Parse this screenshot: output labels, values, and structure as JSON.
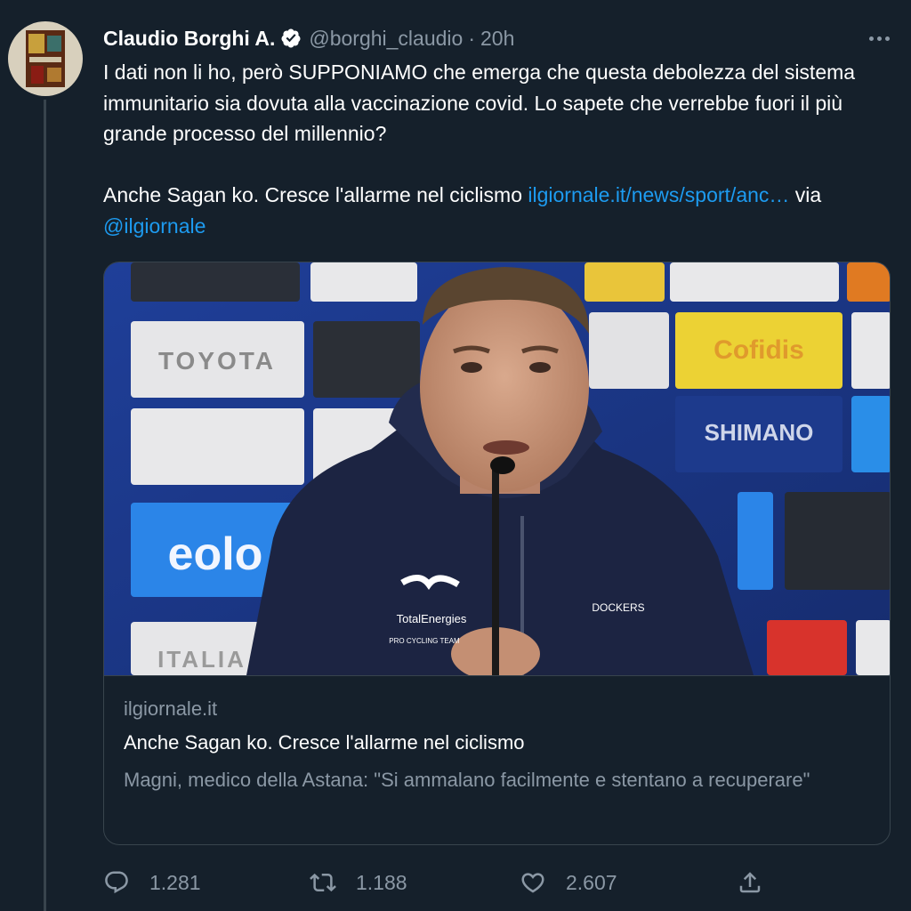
{
  "author": {
    "name": "Claudio Borghi A.",
    "handle": "@borghi_claudio",
    "separator": "·",
    "time": "20h"
  },
  "tweet": {
    "paragraph1": "I dati non li ho, però SUPPONIAMO che emerga che questa debolezza del sistema immunitario sia dovuta alla vaccinazione covid. Lo sapete che verrebbe fuori il più grande processo del millennio?",
    "paragraph2_text": "Anche Sagan ko. Cresce l'allarme nel ciclismo ",
    "paragraph2_link": "ilgiornale.it/news/sport/anc…",
    "via_text": " via ",
    "mention": "@ilgiornale"
  },
  "card": {
    "domain": "ilgiornale.it",
    "title": "Anche Sagan ko. Cresce l'allarme nel ciclismo",
    "description": "Magni, medico della Astana: \"Si ammalano facilmente e stentano a recuperare\"",
    "image_sponsors": [
      "TOYOTA",
      "Cofidis",
      "SHIMANO",
      "eolo",
      "ITALIA"
    ],
    "jersey_text": [
      "TotalEnergies",
      "PRO CYCLING TEAM",
      "DOCKERS"
    ]
  },
  "actions": {
    "replies": "1.281",
    "retweets": "1.188",
    "likes": "2.607"
  },
  "colors": {
    "background": "#15202b",
    "accent": "#1d9bf0",
    "muted": "#8b98a5",
    "border": "#38444d"
  },
  "icons": [
    "verified-badge-icon",
    "more-icon",
    "reply-icon",
    "retweet-icon",
    "like-icon",
    "share-icon"
  ]
}
